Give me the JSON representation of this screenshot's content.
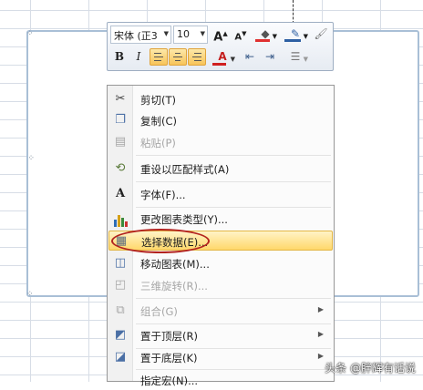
{
  "mini_toolbar": {
    "font_name": "宋体 (正3",
    "font_size": "10",
    "grow_font_icon": "A",
    "shrink_font_icon": "A",
    "bold": "B",
    "italic": "I",
    "font_color_icon": "A"
  },
  "menu": {
    "items": [
      {
        "label": "剪切(T)",
        "icon": "scissors-icon",
        "glyph": "✂"
      },
      {
        "label": "复制(C)",
        "icon": "copy-icon",
        "glyph": "❐"
      },
      {
        "label": "粘贴(P)",
        "icon": "paste-icon",
        "glyph": "▤",
        "disabled": true
      },
      {
        "label": "重设以匹配样式(A)",
        "icon": "reset-style-icon",
        "glyph": "⟲"
      },
      {
        "label": "字体(F)...",
        "icon": "font-icon",
        "glyph": "A"
      },
      {
        "label": "更改图表类型(Y)...",
        "icon": "chart-type-icon",
        "glyph": "▮"
      },
      {
        "label": "选择数据(E)...",
        "icon": "select-data-icon",
        "glyph": "▦",
        "highlighted": true
      },
      {
        "label": "移动图表(M)...",
        "icon": "move-chart-icon",
        "glyph": "◫"
      },
      {
        "label": "三维旋转(R)...",
        "icon": "3d-rotation-icon",
        "glyph": "◰",
        "disabled": true
      },
      {
        "label": "组合(G)",
        "icon": "group-icon",
        "glyph": "⧉",
        "disabled": true,
        "submenu": true
      },
      {
        "label": "置于顶层(R)",
        "icon": "bring-to-front-icon",
        "glyph": "◩",
        "submenu": true
      },
      {
        "label": "置于底层(K)",
        "icon": "send-to-back-icon",
        "glyph": "◪",
        "submenu": true
      },
      {
        "label": "指定宏(N)...",
        "icon": "macro-icon",
        "glyph": ""
      }
    ]
  },
  "watermark": "头条 @胖辉有话说",
  "colors": {
    "highlight": "#ffd86b",
    "annotation_ellipse": "#b3231f",
    "chart_border": "#a9bfd6"
  }
}
